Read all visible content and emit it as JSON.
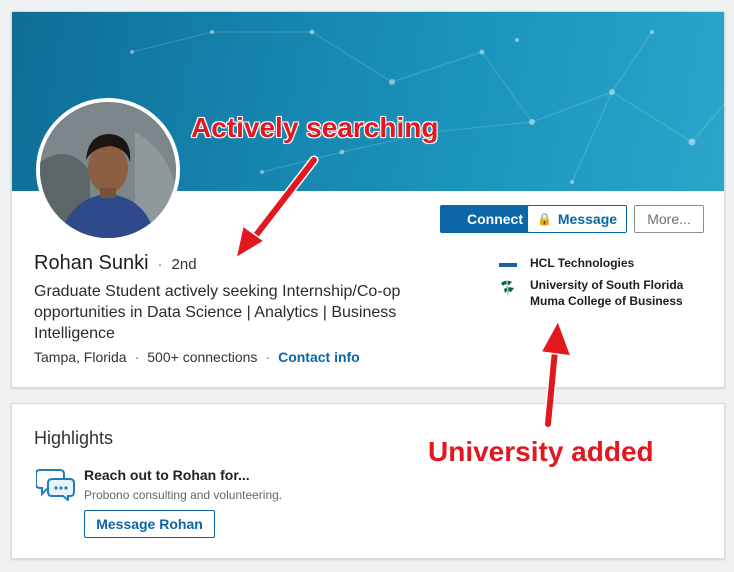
{
  "profile": {
    "name": "Rohan Sunki",
    "degree": "2nd",
    "headline": "Graduate Student actively seeking Internship/Co-op opportunities in Data Science | Analytics | Business Intelligence",
    "location": "Tampa, Florida",
    "connections": "500+ connections",
    "contact_link": "Contact info",
    "actions": {
      "connect": "Connect",
      "message": "Message",
      "more": "More..."
    },
    "experience": [
      {
        "company": "HCL Technologies",
        "icon": "hcl-logo"
      },
      {
        "company": "University of South Florida Muma College of Business",
        "icon": "usf-logo"
      }
    ]
  },
  "highlights": {
    "title": "Highlights",
    "reach_title": "Reach out to Rohan for...",
    "reach_sub": "Probono consulting and volunteering.",
    "button": "Message Rohan",
    "icon": "chat-bubbles-icon"
  },
  "annotations": {
    "active": "Actively searching",
    "university": "University added"
  },
  "colors": {
    "primary": "#0a66a7",
    "annotation": "#e2171f",
    "banner": "#1584ad"
  }
}
